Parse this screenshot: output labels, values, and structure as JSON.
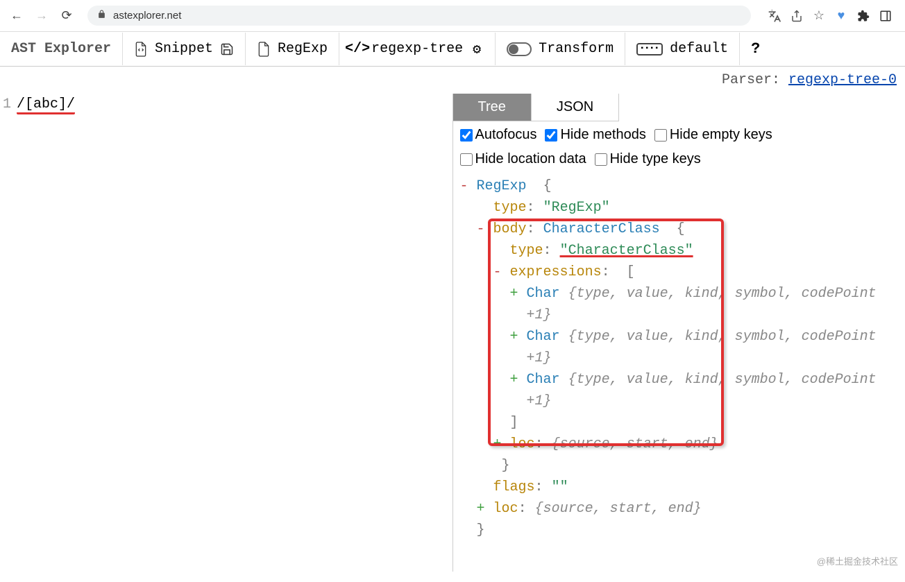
{
  "browser": {
    "url": "astexplorer.net"
  },
  "toolbar": {
    "logo": "AST Explorer",
    "snippet": "Snippet",
    "language": "RegExp",
    "parser": "regexp-tree",
    "transform": "Transform",
    "keymap": "default"
  },
  "parserLine": {
    "label": "Parser: ",
    "link": "regexp-tree-0"
  },
  "editor": {
    "lineNum": "1",
    "code": "/[abc]/"
  },
  "tabs": {
    "tree": "Tree",
    "json": "JSON"
  },
  "options": {
    "autofocus": "Autofocus",
    "hideMethods": "Hide methods",
    "hideEmpty": "Hide empty keys",
    "hideLocation": "Hide location data",
    "hideType": "Hide type keys"
  },
  "tree": {
    "root": "RegExp",
    "rootOpen": "{",
    "typeKey": "type",
    "typeVal": "\"RegExp\"",
    "bodyKey": "body",
    "bodyType": "CharacterClass",
    "bodyOpen": "{",
    "charClassKey": "type",
    "charClassVal": "\"CharacterClass\"",
    "exprKey": "expressions",
    "exprOpen": "[",
    "charLabel": "Char",
    "charPreview": "{type, value, kind, symbol, codePoint",
    "charPlus": "+1}",
    "exprClose": "]",
    "locKey": "loc",
    "locPreview": "{source, start, end}",
    "bodyClose": "}",
    "flagsKey": "flags",
    "flagsVal": "\"\"",
    "rootClose": "}"
  },
  "watermark": "@稀土掘金技术社区"
}
